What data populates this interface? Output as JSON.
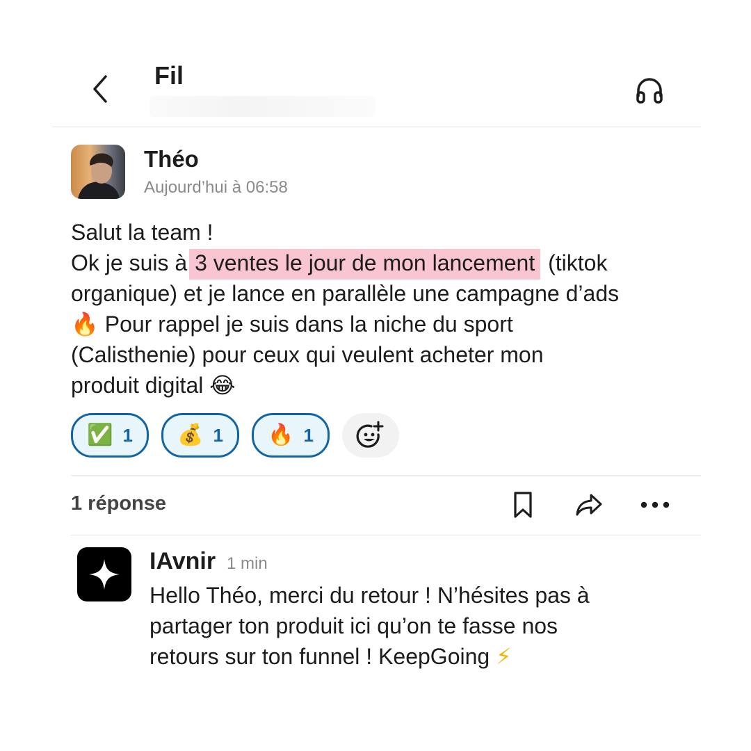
{
  "header": {
    "title": "Fil",
    "back_icon": "chevron-left-icon",
    "audio_icon": "headphones-icon"
  },
  "post": {
    "author": "Théo",
    "timestamp": "Aujourd’hui à 06:58",
    "lines": {
      "l1": "Salut la team !",
      "l2_before": "Ok je suis à ",
      "l2_highlight": "3 ventes le jour de mon lancement",
      "l2_after": " (tiktok",
      "l3": "organique) et je lance en parallèle une campagne d’ads",
      "l4_emoji": "🔥",
      "l4_text": " Pour rappel je suis dans la niche du sport",
      "l5": "(Calisthenie) pour ceux qui veulent acheter mon",
      "l6_text": "produit digital ",
      "l6_emoji": "😂"
    },
    "highlight_color": "#f9c5d1"
  },
  "reactions": [
    {
      "emoji": "✅",
      "count": "1"
    },
    {
      "emoji": "💰",
      "count": "1"
    },
    {
      "emoji": "🔥",
      "count": "1"
    }
  ],
  "reaction_accent": "#1264a3",
  "thread": {
    "reply_count": "1 réponse",
    "actions": [
      "bookmark-icon",
      "share-icon",
      "more-icon"
    ]
  },
  "reply": {
    "author": "IAvnir",
    "timestamp": "1 min",
    "lines": {
      "l1": "Hello Théo, merci du retour ! N’hésites pas à",
      "l2": "partager ton produit ici qu’on te fasse nos",
      "l3_text": "retours sur ton funnel ! KeepGoing ",
      "l3_emoji": "⚡"
    }
  }
}
